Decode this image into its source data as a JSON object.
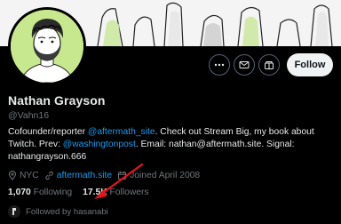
{
  "profile": {
    "name": "Nathan Grayson",
    "handle": "@Vahn16",
    "bio": {
      "p1": "Cofounder/reporter ",
      "link1": "@aftermath_site",
      "p2": ". Check out Stream Big, my book about Twitch. Prev: ",
      "link2": "@washingtonpost",
      "p3": ". Email: nathan@aftermath.site. Signal: nathangrayson.666"
    },
    "location": "NYC",
    "website": "aftermath.site",
    "joined": "Joined April 2008",
    "following_count": "1,070",
    "following_label": "Following",
    "followers_count": "17.5K",
    "followers_label": "Followers",
    "followed_by": "Followed by hasanabi"
  },
  "actions": {
    "follow_label": "Follow"
  },
  "icons": {
    "more": "more-icon",
    "message": "envelope-icon",
    "subscribe": "newsletter-icon",
    "notify": "bell-icon",
    "location": "location-pin-icon",
    "link": "link-icon",
    "calendar": "calendar-icon"
  },
  "colors": {
    "background": "#000000",
    "accent": "#1d9bf0",
    "muted": "#71767b",
    "annotation": "#e0161b",
    "avatar_bg": "#c7e88f"
  }
}
